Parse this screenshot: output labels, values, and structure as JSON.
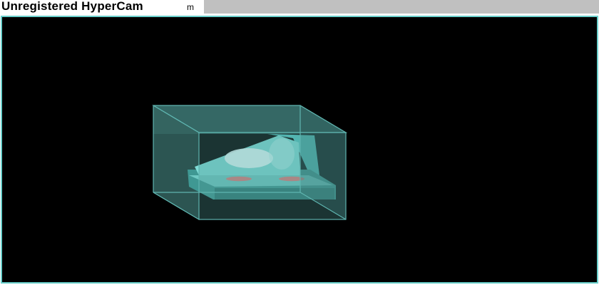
{
  "watermark": {
    "text": "Unregistered HyperCam",
    "suffix": "m"
  },
  "viewport": {
    "background": "#000000",
    "frame_color": "#6ad0cc"
  },
  "model": {
    "box_color": "#5aa8a4",
    "part_color": "#7fdcd6",
    "highlight_color": "#e8ffff",
    "hole_color": "#e87878"
  }
}
